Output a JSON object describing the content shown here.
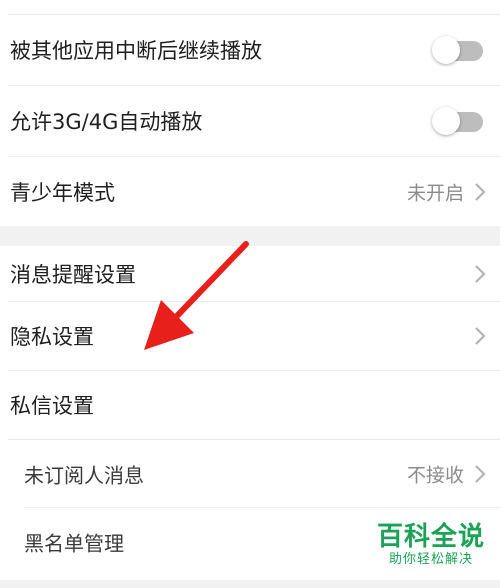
{
  "settings_group_1": {
    "background_resume": {
      "label": "被其他应用中断后继续播放",
      "state": "off"
    },
    "mobile_autoplay": {
      "label": "允许3G/4G自动播放",
      "state": "off"
    },
    "teen_mode": {
      "label": "青少年模式",
      "value": "未开启"
    }
  },
  "settings_group_2": {
    "notifications": {
      "label": "消息提醒设置"
    },
    "privacy": {
      "label": "隐私设置"
    },
    "dm_settings": {
      "label": "私信设置",
      "unsubscribed_messages": {
        "label": "未订阅人消息",
        "value": "不接收"
      },
      "blacklist": {
        "label": "黑名单管理"
      }
    }
  },
  "watermark": {
    "title": "百科全说",
    "subtitle": "助你轻松解决"
  },
  "colors": {
    "arrow": "#e8201c",
    "toggle_track": "#bdbdbd",
    "watermark": "#1aa356",
    "section_gap": "#f1f1f1"
  },
  "icons": {
    "row_arrow": "chevron-right-icon",
    "annotation": "red-arrow-annotation"
  }
}
